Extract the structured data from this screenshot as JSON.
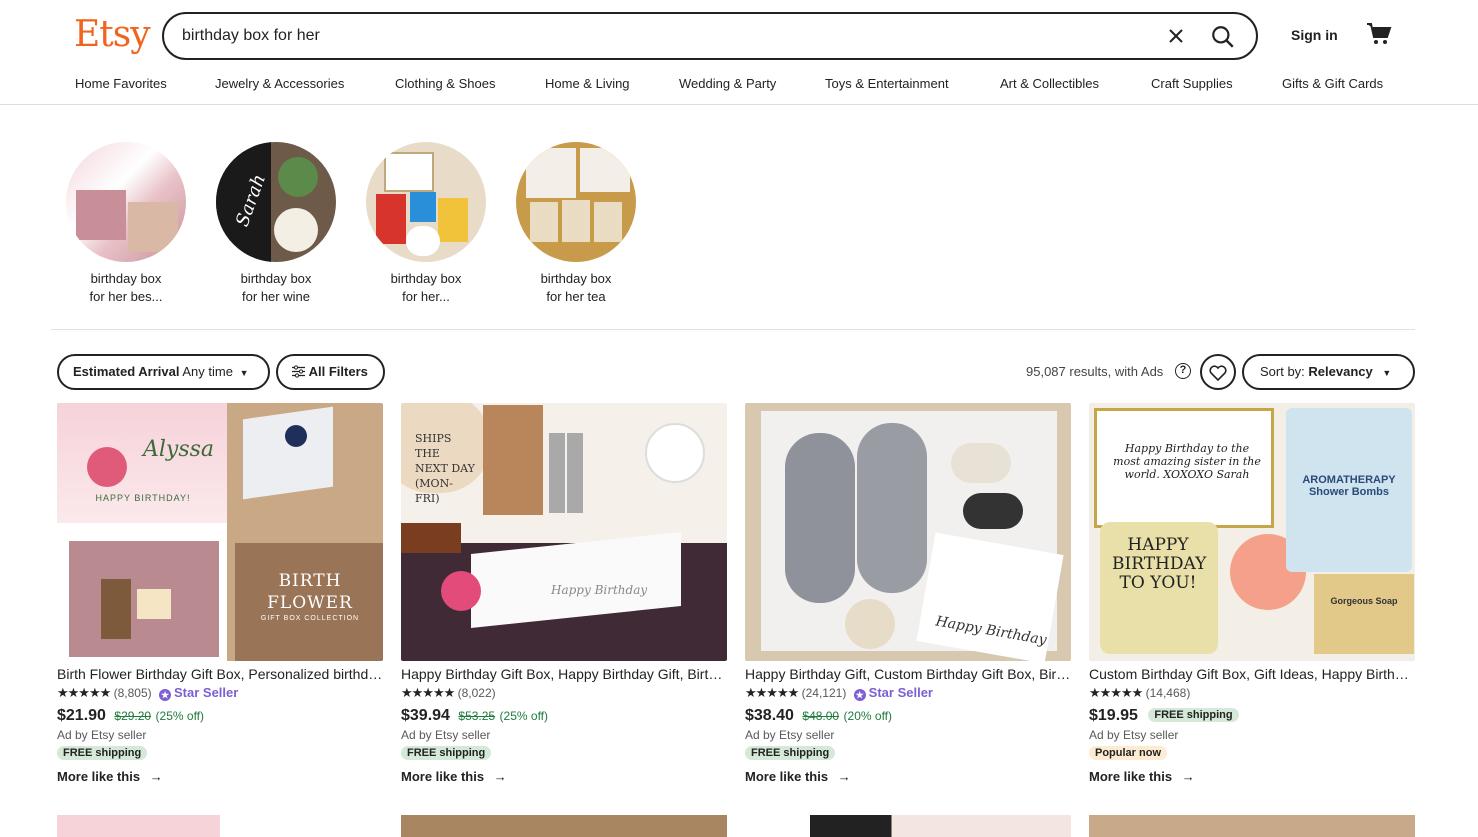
{
  "header": {
    "logo": "Etsy",
    "search_value": "birthday box for her",
    "sign_in": "Sign in"
  },
  "categories": [
    "Home Favorites",
    "Jewelry & Accessories",
    "Clothing & Shoes",
    "Home & Living",
    "Wedding & Party",
    "Toys & Entertainment",
    "Art & Collectibles",
    "Craft Supplies",
    "Gifts & Gift Cards"
  ],
  "suggestions": [
    {
      "line1": "birthday box",
      "line2": "for her bes..."
    },
    {
      "line1": "birthday box",
      "line2": "for her wine"
    },
    {
      "line1": "birthday box",
      "line2": "for her..."
    },
    {
      "line1": "birthday box",
      "line2": "for her tea"
    }
  ],
  "filters": {
    "arrival_label": "Estimated Arrival",
    "arrival_value": "Any time",
    "all_filters": "All Filters",
    "results": "95,087 results, with Ads",
    "sort_label": "Sort by:",
    "sort_value": "Relevancy"
  },
  "listings": [
    {
      "title": "Birth Flower Birthday Gift Box, Personalized birthday gift box for her",
      "stars": "★★★★★",
      "reviews": "(8,805)",
      "star_seller": "Star Seller",
      "price": "$21.90",
      "orig": "$29.20",
      "off": "(25% off)",
      "ad": "Ad by Etsy seller",
      "badge": "FREE shipping",
      "more": "More like this"
    },
    {
      "title": "Happy Birthday Gift Box, Happy Birthday Gift, Birthday Box for Her",
      "stars": "★★★★★",
      "reviews": "(8,022)",
      "star_seller": "",
      "price": "$39.94",
      "orig": "$53.25",
      "off": "(25% off)",
      "ad": "Ad by Etsy seller",
      "badge": "FREE shipping",
      "more": "More like this"
    },
    {
      "title": "Happy Birthday Gift, Custom Birthday Gift Box, Birthday Gift for Her",
      "stars": "★★★★★",
      "reviews": "(24,121)",
      "star_seller": "Star Seller",
      "price": "$38.40",
      "orig": "$48.00",
      "off": "(20% off)",
      "ad": "Ad by Etsy seller",
      "badge": "FREE shipping",
      "more": "More like this"
    },
    {
      "title": "Custom Birthday Gift Box, Gift Ideas, Happy Birthday Box for Her",
      "stars": "★★★★★",
      "reviews": "(14,468)",
      "star_seller": "",
      "price": "$19.95",
      "free_inline": "FREE shipping",
      "ad": "Ad by Etsy seller",
      "badge": "Popular now",
      "more": "More like this"
    }
  ],
  "image_text": {
    "card1_name": "Alyssa",
    "card1_bday": "HAPPY BIRTHDAY!",
    "card1_birth": "BIRTH",
    "card1_flower": "FLOWER",
    "card1_sub": "GIFT BOX COLLECTION",
    "card2_ships": "SHIPS THE NEXT DAY (MON-FRI)",
    "card2_hb": "Happy Birthday",
    "card3_hb": "Happy Birthday",
    "card4_msg": "Happy Birthday to the most amazing sister in the world. XOXOXO Sarah",
    "card4_jar": "HAPPY BIRTHDAY TO YOU!",
    "card4_bombs": "AROMATHERAPY Shower Bombs",
    "card4_soap": "Gorgeous Soap",
    "circle2_name": "Sarah"
  },
  "colors": {
    "brand": "#f1641e",
    "star_seller": "#7d5ed3",
    "sale_green": "#1f7c3e"
  }
}
